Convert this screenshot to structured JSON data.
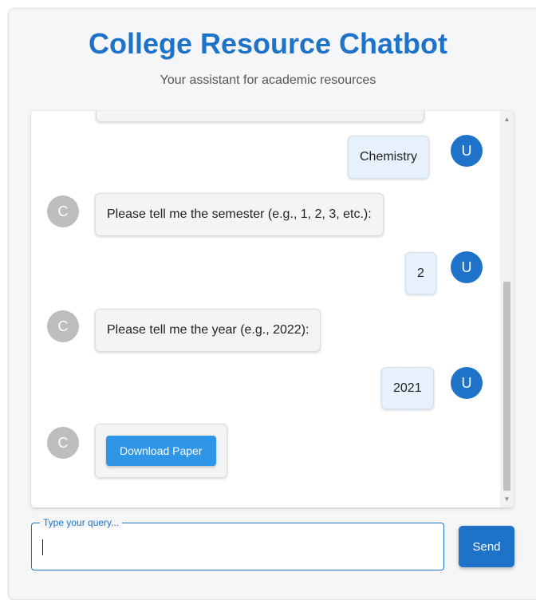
{
  "header": {
    "title": "College Resource Chatbot",
    "subtitle": "Your assistant for academic resources"
  },
  "chat": {
    "messages": [
      {
        "sender": "user",
        "avatar": "U",
        "text": "Chemistry"
      },
      {
        "sender": "bot",
        "avatar": "C",
        "text": "Please tell me the semester (e.g., 1, 2, 3, etc.):"
      },
      {
        "sender": "user",
        "avatar": "U",
        "text": "2"
      },
      {
        "sender": "bot",
        "avatar": "C",
        "text": "Please tell me the year (e.g., 2022):"
      },
      {
        "sender": "user",
        "avatar": "U",
        "text": "2021"
      },
      {
        "sender": "bot",
        "avatar": "C",
        "button_label": "Download Paper"
      }
    ]
  },
  "composer": {
    "label": "Type your query...",
    "value": "",
    "send_label": "Send"
  },
  "colors": {
    "accent": "#1e73c8",
    "download_button": "#2f95e6",
    "bot_avatar": "#bdbdbd",
    "user_bubble": "#e7f1fb"
  },
  "icons": {
    "scroll_up": "scroll-up-arrow-icon",
    "scroll_down": "scroll-down-arrow-icon"
  }
}
